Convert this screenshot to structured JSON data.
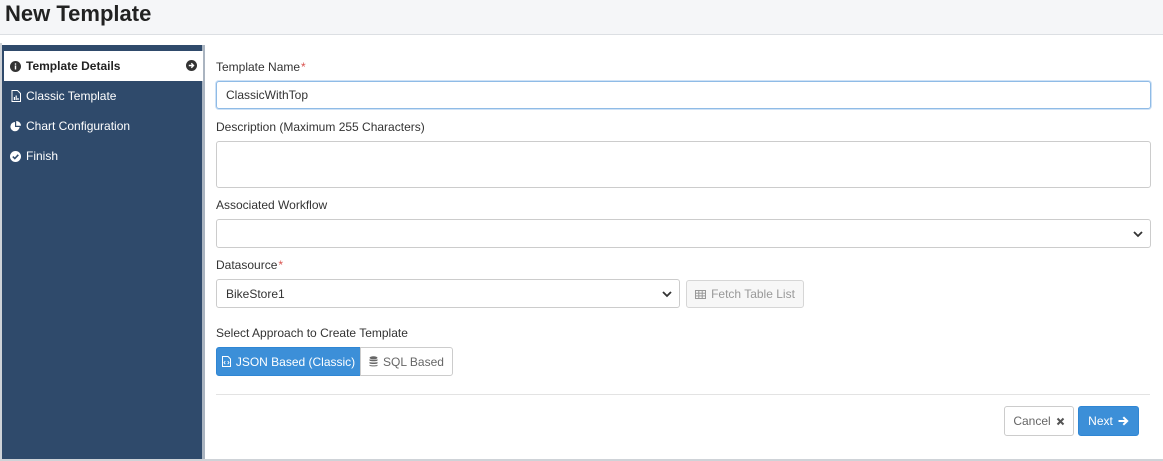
{
  "page": {
    "title": "New Template"
  },
  "sidebar": {
    "items": [
      {
        "label": "Template Details",
        "icon": "info-circle-icon",
        "active": true
      },
      {
        "label": "Classic Template",
        "icon": "file-chart-icon"
      },
      {
        "label": "Chart Configuration",
        "icon": "pie-chart-icon"
      },
      {
        "label": "Finish",
        "icon": "check-circle-icon"
      }
    ]
  },
  "form": {
    "template_name": {
      "label": "Template Name",
      "required_mark": "*",
      "value": "ClassicWithTop"
    },
    "description": {
      "label": "Description (Maximum 255 Characters)",
      "value": ""
    },
    "workflow": {
      "label": "Associated Workflow",
      "selected": ""
    },
    "datasource": {
      "label": "Datasource",
      "required_mark": "*",
      "selected": "BikeStore1",
      "fetch_button": "Fetch Table List"
    },
    "approach": {
      "label": "Select Approach to Create Template",
      "options": [
        {
          "label": "JSON Based (Classic)",
          "selected": true
        },
        {
          "label": "SQL Based",
          "selected": false
        }
      ]
    }
  },
  "footer": {
    "cancel": "Cancel",
    "next": "Next"
  },
  "colors": {
    "sidebar_bg": "#2f4a6b",
    "primary": "#3c8fd8",
    "required": "#d9534f"
  }
}
